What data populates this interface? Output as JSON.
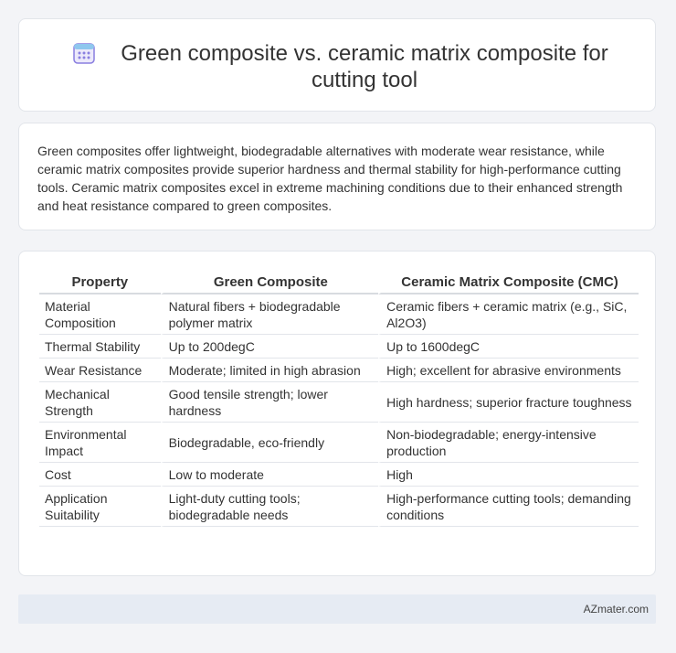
{
  "header": {
    "icon": "calendar-grid-icon",
    "title": "Green composite vs. ceramic matrix composite for cutting tool"
  },
  "intro": {
    "text": "Green composites offer lightweight, biodegradable alternatives with moderate wear resistance, while ceramic matrix composites provide superior hardness and thermal stability for high-performance cutting tools. Ceramic matrix composites excel in extreme machining conditions due to their enhanced strength and heat resistance compared to green composites."
  },
  "table": {
    "headers": [
      "Property",
      "Green Composite",
      "Ceramic Matrix Composite (CMC)"
    ],
    "rows": [
      [
        "Material Composition",
        "Natural fibers + biodegradable polymer matrix",
        "Ceramic fibers + ceramic matrix (e.g., SiC, Al2O3)"
      ],
      [
        "Thermal Stability",
        "Up to 200degC",
        "Up to 1600degC"
      ],
      [
        "Wear Resistance",
        "Moderate; limited in high abrasion",
        "High; excellent for abrasive environments"
      ],
      [
        "Mechanical Strength",
        "Good tensile strength; lower hardness",
        "High hardness; superior fracture toughness"
      ],
      [
        "Environmental Impact",
        "Biodegradable, eco-friendly",
        "Non-biodegradable; energy-intensive production"
      ],
      [
        "Cost",
        "Low to moderate",
        "High"
      ],
      [
        "Application Suitability",
        "Light-duty cutting tools; biodegradable needs",
        "High-performance cutting tools; demanding conditions"
      ]
    ]
  },
  "footer": {
    "site": "AZmater.com"
  },
  "colors": {
    "icon_accent": "#7b6fd6",
    "footer_bg": "#e6ebf3"
  }
}
